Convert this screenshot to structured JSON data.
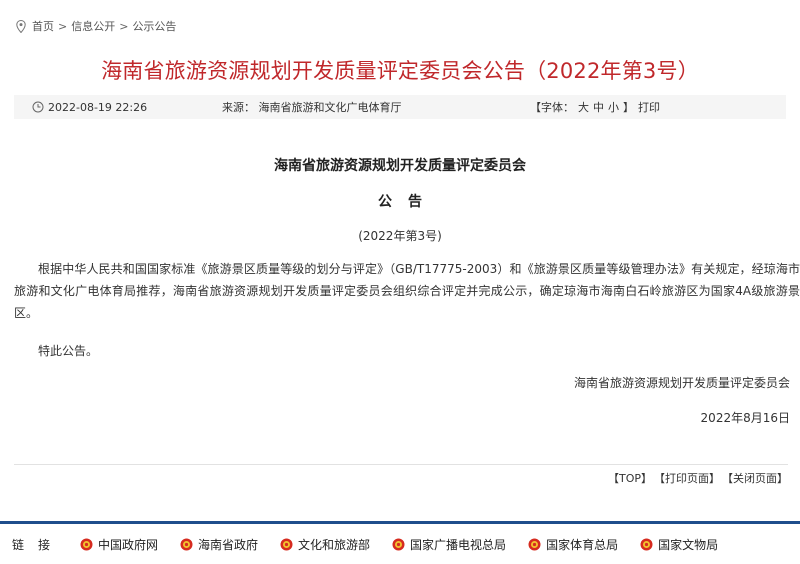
{
  "breadcrumb": {
    "items": [
      "首页",
      "信息公开",
      "公示公告"
    ],
    "separator": ">"
  },
  "title": "海南省旅游资源规划开发质量评定委员会公告（2022年第3号）",
  "meta": {
    "datetime": "2022-08-19 22:26",
    "source": "来源：  海南省旅游和文化广电体育厅",
    "font_open": "【字体：",
    "font_large": "大",
    "font_medium": "中",
    "font_small": "小",
    "font_close": "】",
    "print": "打印"
  },
  "document": {
    "heading": "海南省旅游资源规划开发质量评定委员会",
    "subheading": "公告",
    "number": "(2022年第3号)",
    "body": "根据中华人民共和国国家标准《旅游景区质量等级的划分与评定》（GB/T17775-2003）和《旅游景区质量等级管理办法》有关规定，经琼海市旅游和文化广电体育局推荐，海南省旅游资源规划开发质量评定委员会组织综合评定并完成公示，确定琼海市海南白石岭旅游区为国家4A级旅游景区。",
    "closing": "特此公告。",
    "signer": "海南省旅游资源规划开发质量评定委员会",
    "date": "2022年8月16日"
  },
  "actions": {
    "top": "【TOP】",
    "print_page": "【打印页面】",
    "close_page": "【关闭页面】"
  },
  "links": {
    "label": "链接",
    "items": [
      "中国政府网",
      "海南省政府",
      "文化和旅游部",
      "国家广播电视总局",
      "国家体育总局",
      "国家文物局"
    ]
  },
  "colors": {
    "title": "#c0282b",
    "footer_bar": "#1f4e8c",
    "meta_bg": "#f5f5f5"
  }
}
